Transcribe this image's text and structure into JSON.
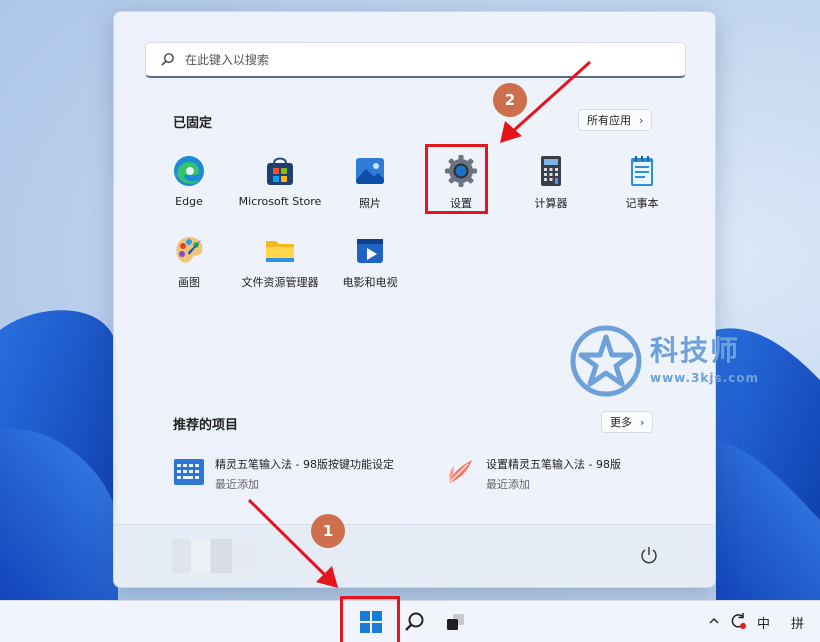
{
  "search": {
    "placeholder": "在此键入以搜索"
  },
  "pinned": {
    "title": "已固定",
    "all_apps_label": "所有应用",
    "apps": [
      {
        "label": "Edge",
        "icon": "edge-icon"
      },
      {
        "label": "Microsoft Store",
        "icon": "store-icon"
      },
      {
        "label": "照片",
        "icon": "photos-icon"
      },
      {
        "label": "设置",
        "icon": "settings-gear-icon"
      },
      {
        "label": "计算器",
        "icon": "calculator-icon"
      },
      {
        "label": "记事本",
        "icon": "notepad-icon"
      },
      {
        "label": "画图",
        "icon": "paint-icon"
      },
      {
        "label": "文件资源管理器",
        "icon": "file-explorer-icon"
      },
      {
        "label": "电影和电视",
        "icon": "movies-tv-icon"
      }
    ]
  },
  "recommended": {
    "title": "推荐的项目",
    "more_label": "更多",
    "items": [
      {
        "title": "精灵五笔输入法 - 98版按键功能设定",
        "subtitle": "最近添加",
        "icon": "keyboard-icon"
      },
      {
        "title": "设置精灵五笔输入法 - 98版",
        "subtitle": "最近添加",
        "icon": "feather-icon"
      }
    ]
  },
  "watermark": {
    "name": "科技师",
    "url": "www.3kjs.com"
  },
  "taskbar": {
    "tray_ime_1": "中",
    "tray_ime_2": "拼"
  },
  "annotations": {
    "step1": "1",
    "step2": "2"
  },
  "colors": {
    "highlight": "#e5151d",
    "badge": "#cd6f4d",
    "accent": "#1a73c7"
  }
}
